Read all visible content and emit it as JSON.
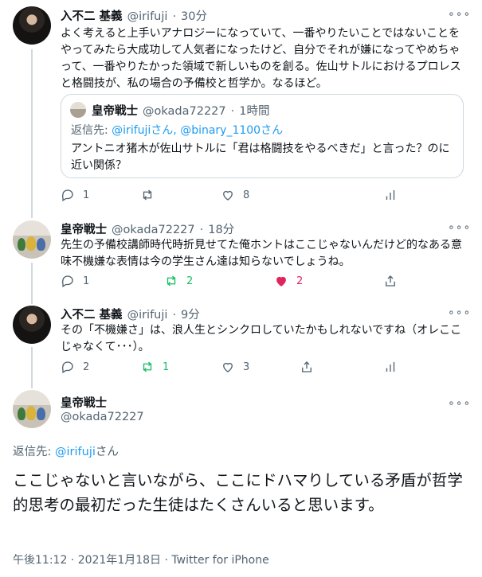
{
  "tweets": [
    {
      "name": "入不二 基義",
      "handle": "@irifuji",
      "time": "30分",
      "body": "よく考えると上手いアナロジーになっていて、一番やりたいことではないことをやってみたら大成功して人気者になったけど、自分でそれが嫌になってやめちゃって、一番やりたかった領域で新しいものを創る。佐山サトルにおけるプロレスと格闘技が、私の場合の予備校と哲学か。なるほど。",
      "quote": {
        "name": "皇帝戦士",
        "handle": "@okada72227",
        "time": "1時間",
        "reply_prefix": "返信先: ",
        "reply_users": "@irifujiさん, @binary_1100さん",
        "body": "アントニオ猪木が佐山サトルに「君は格闘技をやるべきだ」と言った？のに近い関係？"
      },
      "replies": "1",
      "retweets": "",
      "likes": "8"
    },
    {
      "name": "皇帝戦士",
      "handle": "@okada72227",
      "time": "18分",
      "body": "先生の予備校講師時代時折見せてた俺ホントはここじゃないんだけど的なある意味不機嫌な表情は今の学生さん達は知らないでしょうね。",
      "replies": "1",
      "retweets": "2",
      "likes": "2"
    },
    {
      "name": "入不二 基義",
      "handle": "@irifuji",
      "time": "9分",
      "body": "その「不機嫌さ」は、浪人生とシンクロしていたかもしれないですね（オレここじゃなくて･･･）。",
      "replies": "2",
      "retweets": "1",
      "likes": "3"
    }
  ],
  "main_tweet": {
    "name": "皇帝戦士",
    "handle": "@okada72227",
    "reply_prefix": "返信先: ",
    "reply_user": "@irifuji",
    "reply_suffix": "さん",
    "body": "ここじゃないと言いながら、ここにドハマりしている矛盾が哲学的思考の最初だった生徒はたくさんいると思います。",
    "timestamp": "午後11:12 · 2021年1月18日 · ",
    "source": "Twitter for iPhone"
  },
  "more_glyph": "∘∘∘",
  "sep": " · "
}
